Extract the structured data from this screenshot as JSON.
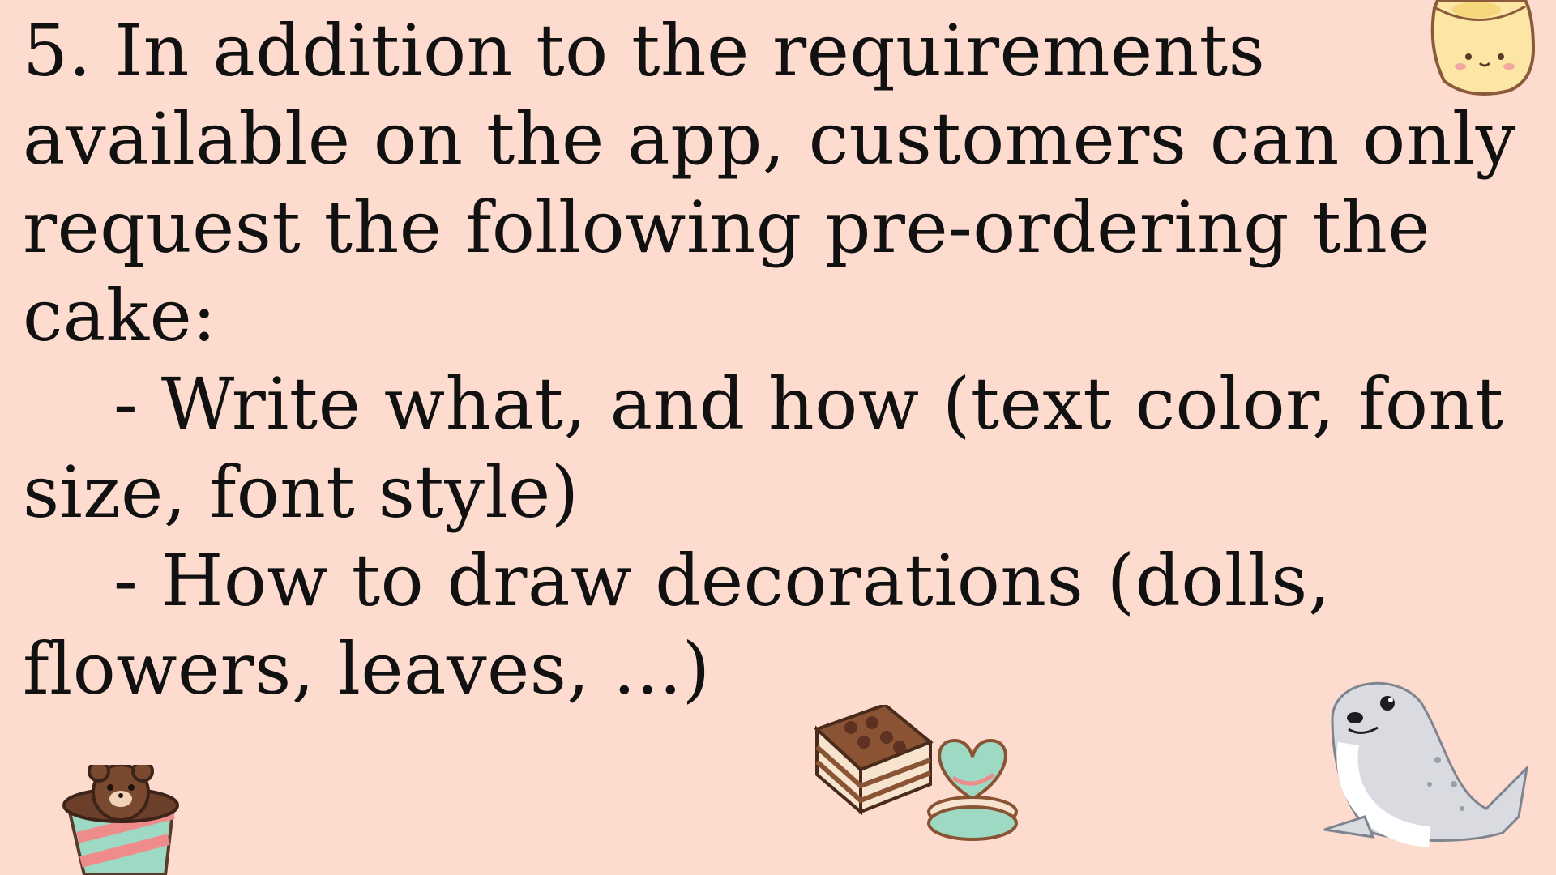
{
  "slide": {
    "background": "#fddccf",
    "text_color": "#111111",
    "lines": [
      "5. In addition to the requirements",
      "available on the app, customers can only",
      "request the following pre-ordering the",
      "cake:",
      "- Write what, and how (text color, font",
      "size, font style)",
      "- How to draw decorations (dolls,",
      "flowers, leaves, ...)"
    ]
  },
  "decorations": [
    {
      "name": "pudding-cup-illustration"
    },
    {
      "name": "bear-drink-cup-illustration"
    },
    {
      "name": "tiramisu-cake-illustration"
    },
    {
      "name": "heart-macaron-illustration"
    },
    {
      "name": "seal-illustration"
    }
  ]
}
